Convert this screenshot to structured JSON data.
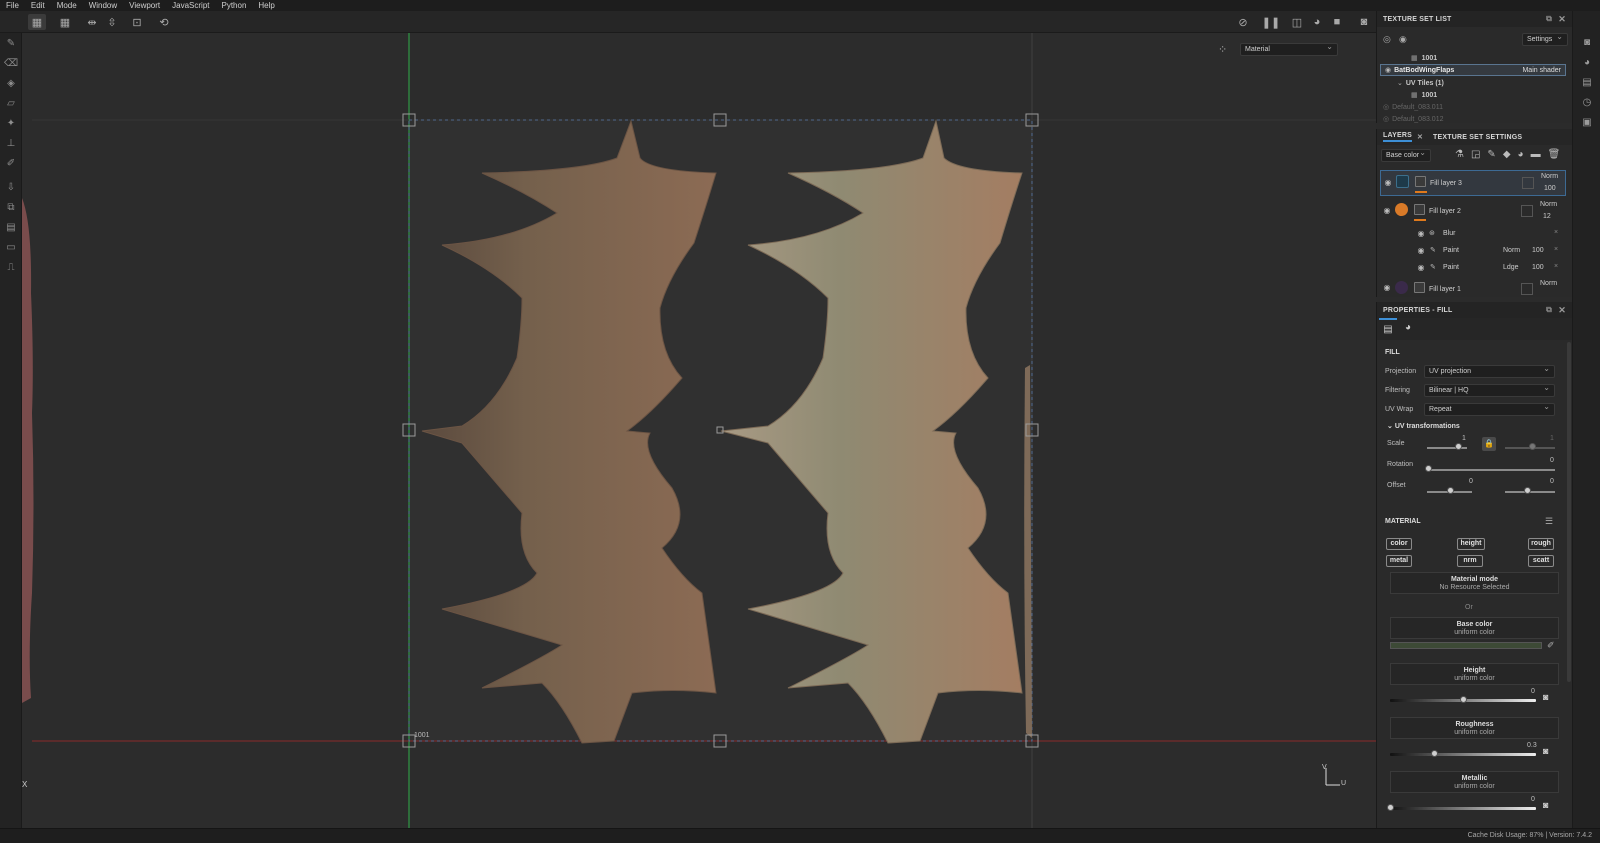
{
  "menu": [
    "File",
    "Edit",
    "Mode",
    "Window",
    "Viewport",
    "JavaScript",
    "Python",
    "Help"
  ],
  "viewport": {
    "material_dropdown": "Material",
    "tile_label": "1001",
    "axis_x": "X",
    "axis_v": "V",
    "axis_u": "U"
  },
  "texture_set_list": {
    "title": "TEXTURE SET LIST",
    "settings": "Settings",
    "items": [
      {
        "label": "1001",
        "kind": "tile"
      },
      {
        "label": "BatBodWingFlaps",
        "kind": "set",
        "shader": "Main shader"
      },
      {
        "label": "UV Tiles (1)",
        "kind": "group"
      },
      {
        "label": "1001",
        "kind": "tile"
      },
      {
        "label": "Default_083.011",
        "kind": "dim"
      },
      {
        "label": "Default_083.012",
        "kind": "dim"
      }
    ]
  },
  "layers_panel": {
    "tab_layers": "LAYERS",
    "tab_tss": "TEXTURE SET SETTINGS",
    "channel": "Base color",
    "layers": [
      {
        "name": "Fill layer 3",
        "blend": "Norm",
        "opacity": "100",
        "thumb": "#1e3a4a"
      },
      {
        "name": "Fill layer 2",
        "blend": "Norm",
        "opacity": "12",
        "thumb": "#d97a28"
      },
      {
        "name": "Blur",
        "sub": true
      },
      {
        "name": "Paint",
        "sub": true,
        "blend": "Norm",
        "opacity": "100"
      },
      {
        "name": "Paint",
        "sub": true,
        "blend": "Ldge",
        "opacity": "100"
      },
      {
        "name": "Fill layer 1",
        "blend": "Norm",
        "thumb": "#3a2a4a"
      }
    ]
  },
  "properties": {
    "title": "PROPERTIES - FILL",
    "fill_heading": "FILL",
    "projection_label": "Projection",
    "projection_value": "UV projection",
    "filtering_label": "Filtering",
    "filtering_value": "Bilinear | HQ",
    "uvwrap_label": "UV Wrap",
    "uvwrap_value": "Repeat",
    "uvtrans_heading": "UV transformations",
    "scale_label": "Scale",
    "scale_value": "1",
    "scale_value2": "1",
    "rotation_label": "Rotation",
    "rotation_value": "0",
    "offset_label": "Offset",
    "offset_value1": "0",
    "offset_value2": "0",
    "material_heading": "MATERIAL",
    "chips": [
      "color",
      "height",
      "rough",
      "metal",
      "nrm",
      "scatt"
    ],
    "material_mode_title": "Material mode",
    "material_mode_sub": "No Resource Selected",
    "or": "Or",
    "base_color_title": "Base color",
    "base_color_sub": "uniform color",
    "base_color_swatch": "#3d4a36",
    "height_title": "Height",
    "height_sub": "uniform color",
    "height_value": "0",
    "height_level": 0.5,
    "roughness_title": "Roughness",
    "roughness_sub": "uniform color",
    "roughness_value": "0.3",
    "roughness_level": 0.3,
    "metallic_title": "Metallic",
    "metallic_sub": "uniform color",
    "metallic_value": "0",
    "metallic_level": 0
  },
  "status": "Cache Disk Usage:   87%  |  Version: 7.4.2"
}
